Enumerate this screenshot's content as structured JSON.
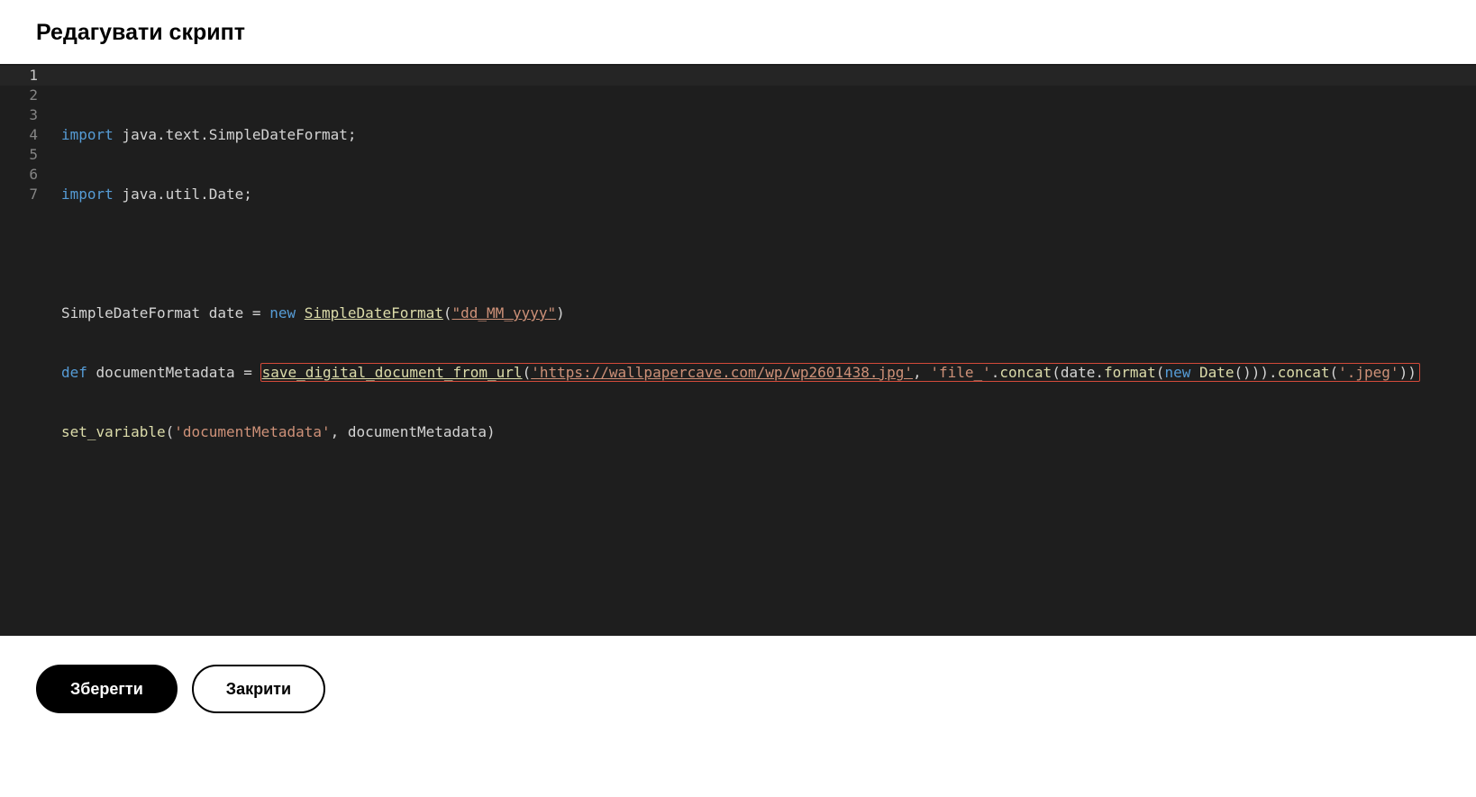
{
  "header": {
    "title": "Редагувати скрипт"
  },
  "editor": {
    "line_numbers": [
      "1",
      "2",
      "3",
      "4",
      "5",
      "6",
      "7"
    ],
    "current_line_index": 0,
    "code": {
      "l1": {
        "kw": "import",
        "rest": " java.text.SimpleDateFormat;"
      },
      "l2": {
        "kw": "import",
        "rest": " java.util.Date;"
      },
      "l3": "",
      "l4": {
        "a": "SimpleDateFormat date ",
        "op": "=",
        "sp": " ",
        "kw": "new",
        "fn_sp": " ",
        "fn": "SimpleDateFormat",
        "p_open": "(",
        "str": "\"dd_MM_yyyy\"",
        "p_close": ")"
      },
      "l5": {
        "kw": "def",
        "a": " documentMetadata ",
        "op": "=",
        "sp": " ",
        "box": {
          "fn1": "save_digital_document_from_url",
          "p_open": "(",
          "str1": "'https://wallpapercave.com/wp/wp2601438.jpg'",
          "comma1": ", ",
          "str2": "'file_'",
          "dot1": ".",
          "fn2": "concat",
          "p2_open": "(",
          "a2": "date.",
          "fn3": "format",
          "p3_open": "(",
          "kw2": "new",
          "sp2": " ",
          "fn4": "Date",
          "p4": "()))",
          "dot2": ".",
          "fn5": "concat",
          "p5_open": "(",
          "str3": "'.jpeg'",
          "p5_close": "))"
        }
      },
      "l6": {
        "fn": "set_variable",
        "p_open": "(",
        "str": "'documentMetadata'",
        "comma": ", documentMetadata",
        "p_close": ")"
      },
      "l7": ""
    }
  },
  "footer": {
    "save_label": "Зберегти",
    "close_label": "Закрити"
  }
}
